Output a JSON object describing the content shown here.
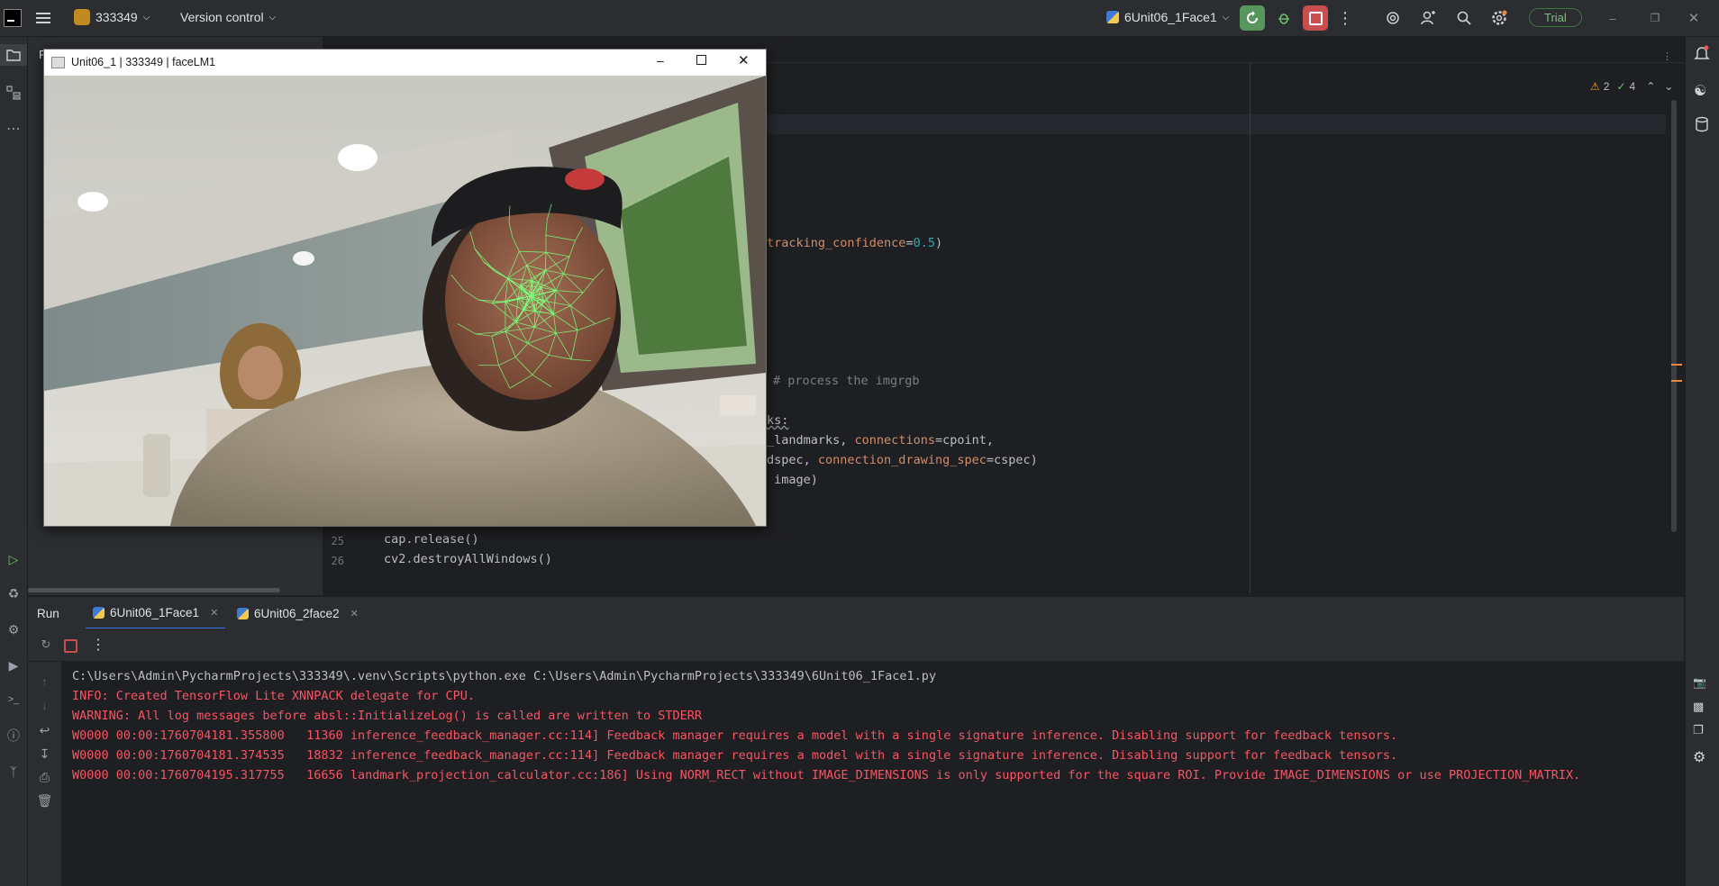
{
  "titlebar": {
    "project_name": "333349",
    "vcs_label": "Version control",
    "run_config": "6Unit06_1Face1",
    "trial_label": "Trial"
  },
  "editor": {
    "inspections": {
      "warnings": "2",
      "ok": "4"
    },
    "lines": [
      {
        "num": "",
        "frag": "tracking_confidence=0.5)"
      },
      {
        "num": "",
        "frag": "# process the imgrgb"
      },
      {
        "num": "",
        "frag": "ks:"
      },
      {
        "num": "",
        "frag": "_landmarks, connections=cpoint,"
      },
      {
        "num": "",
        "frag": "dspec, connection_drawing_spec=cspec)"
      },
      {
        "num": "",
        "frag": " image)"
      },
      {
        "num": "25",
        "frag": "cap.release()"
      },
      {
        "num": "26",
        "frag": "cv2.destroyAllWindows()"
      }
    ]
  },
  "run": {
    "title": "Run",
    "tabs": [
      {
        "label": "6Unit06_1Face1"
      },
      {
        "label": "6Unit06_2face2"
      }
    ],
    "console": [
      {
        "text": "C:\\Users\\Admin\\PycharmProjects\\333349\\.venv\\Scripts\\python.exe C:\\Users\\Admin\\PycharmProjects\\333349\\6Unit06_1Face1.py",
        "color": "#bcbec4"
      },
      {
        "text": "INFO: Created TensorFlow Lite XNNPACK delegate for CPU.",
        "color": "#f75464"
      },
      {
        "text": "WARNING: All log messages before absl::InitializeLog() is called are written to STDERR",
        "color": "#f75464"
      },
      {
        "text": "W0000 00:00:1760704181.355800   11360 inference_feedback_manager.cc:114] Feedback manager requires a model with a single signature inference. Disabling support for feedback tensors.",
        "color": "#f75464"
      },
      {
        "text": "W0000 00:00:1760704181.374535   18832 inference_feedback_manager.cc:114] Feedback manager requires a model with a single signature inference. Disabling support for feedback tensors.",
        "color": "#f75464"
      },
      {
        "text": "W0000 00:00:1760704195.317755   16656 landmark_projection_calculator.cc:186] Using NORM_RECT without IMAGE_DIMENSIONS is only supported for the square ROI. Provide IMAGE_DIMENSIONS or use PROJECTION_MATRIX.",
        "color": "#f75464"
      }
    ]
  },
  "camwindow": {
    "title": "Unit06_1 | 333349 | faceLM1"
  },
  "colors": {
    "accent_green": "#57965c",
    "stop_red": "#c94f4f",
    "error_text": "#f75464",
    "mesh": "#7dff7d"
  }
}
